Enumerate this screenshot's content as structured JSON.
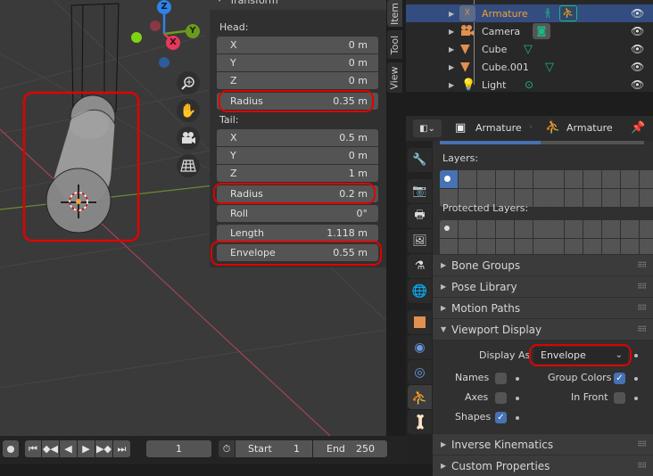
{
  "viewport": {
    "gizmo": {
      "z_label": "Z",
      "y_label": "Y",
      "x_label": "X",
      "z_color": "#2f83e6",
      "y_color": "#6b9a1e",
      "x_color": "#e6395a",
      "neg_y_color": "#7fd411",
      "neg_x_color": "#8a3845",
      "neg_z_color": "#2d5c99"
    },
    "nav_buttons": [
      "zoom-icon",
      "hand-pan-icon",
      "camera-icon",
      "grid-ortho-icon"
    ]
  },
  "n_panel": {
    "section_title": "Transform",
    "head_label": "Head:",
    "head": [
      {
        "label": "X",
        "value": "0 m"
      },
      {
        "label": "Y",
        "value": "0 m"
      },
      {
        "label": "Z",
        "value": "0 m"
      }
    ],
    "head_radius": {
      "label": "Radius",
      "value": "0.35 m"
    },
    "tail_label": "Tail:",
    "tail": [
      {
        "label": "X",
        "value": "0.5 m"
      },
      {
        "label": "Y",
        "value": "0 m"
      },
      {
        "label": "Z",
        "value": "1 m"
      }
    ],
    "tail_radius": {
      "label": "Radius",
      "value": "0.2 m"
    },
    "roll": {
      "label": "Roll",
      "value": "0°"
    },
    "length": {
      "label": "Length",
      "value": "1.118 m"
    },
    "envelope": {
      "label": "Envelope",
      "value": "0.55 m"
    },
    "side_tabs": [
      "Item",
      "Tool",
      "View"
    ]
  },
  "outliner": {
    "items": [
      {
        "name": "Armature",
        "selected": true
      },
      {
        "name": "Camera",
        "selected": false
      },
      {
        "name": "Cube",
        "selected": false
      },
      {
        "name": "Cube.001",
        "selected": false
      },
      {
        "name": "Light",
        "selected": false
      }
    ]
  },
  "properties": {
    "breadcrumb_object": "Armature",
    "breadcrumb_data": "Armature",
    "layers_label": "Layers:",
    "protected_layers_label": "Protected Layers:",
    "sections": {
      "bone_groups": "Bone Groups",
      "pose_library": "Pose Library",
      "motion_paths": "Motion Paths",
      "viewport_display": "Viewport Display",
      "inverse_kinematics": "Inverse Kinematics",
      "custom_properties": "Custom Properties"
    },
    "viewport_display": {
      "display_as_label": "Display As",
      "display_as_value": "Envelope",
      "names_label": "Names",
      "names_checked": false,
      "axes_label": "Axes",
      "axes_checked": false,
      "shapes_label": "Shapes",
      "shapes_checked": true,
      "group_colors_label": "Group Colors",
      "group_colors_checked": true,
      "in_front_label": "In Front",
      "in_front_checked": false
    }
  },
  "timeline": {
    "current_frame": "1",
    "start_label": "Start",
    "start_value": "1",
    "end_label": "End",
    "end_value": "250"
  },
  "colors": {
    "accent": "#4772b3",
    "highlight_ring": "#e00000",
    "selected_text": "#f0a030",
    "data_green": "#1fb58a"
  }
}
